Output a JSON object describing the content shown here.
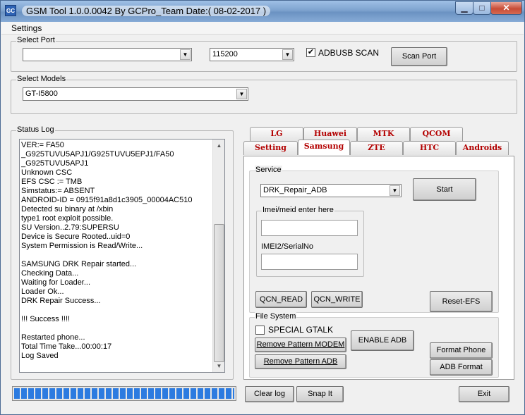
{
  "title": "GSM Tool 1.0.0.0042 By GCPro_Team  Date:( 08-02-2017 )",
  "app_icon": "GC",
  "window_controls": {
    "minimize": "▁",
    "maximize": "□",
    "close": "✕"
  },
  "menu": {
    "settings": "Settings"
  },
  "select_port": {
    "legend": "Select Port",
    "port_value": "",
    "baud_value": "115200",
    "adbusb_label": "ADBUSB SCAN",
    "adbusb_checked": "✔",
    "scan_button": "Scan Port"
  },
  "select_models": {
    "legend": "Select Models",
    "model_value": "GT-I5800"
  },
  "status_log": {
    "legend": "Status Log",
    "text": "VER:= FA50\n_G925TUVU5APJ1/G925TUVU5EPJ1/FA50\n_G925TUVU5APJ1\nUnknown CSC\nEFS CSC := TMB\nSimstatus:= ABSENT\nANDROID-ID = 0915f91a8d1c3905_00004AC510\nDetected su binary at /xbin\ntype1 root exploit possible.\nSU Version..2.79:SUPERSU\nDevice is Secure Rooted..uid=0\nSystem Permission is Read/Write...\n\nSAMSUNG DRK Repair started...\nChecking Data...\nWaiting for Loader...\nLoader Ok...\nDRK Repair Success...\n\n!!! Success !!!!\n\nRestarted phone...\nTotal Time Take...00:00:17\nLog Saved"
  },
  "progress": {
    "fraction": 1.0
  },
  "tabs_row1": [
    "LG",
    "Huawei",
    "MTK",
    "QCOM"
  ],
  "tabs_row2": [
    "Setting",
    "Samsung",
    "ZTE",
    "HTC",
    "Androids"
  ],
  "active_tab": "Samsung",
  "service": {
    "legend": "Service",
    "selected": "DRK_Repair_ADB",
    "start_button": "Start",
    "imei_legend": "Imei/meid enter here",
    "imei_value": "",
    "imei2_label": "IMEI2/SerialNo",
    "imei2_value": "",
    "qcn_read": "QCN_READ",
    "qcn_write": "QCN_WRITE",
    "reset_efs": "Reset-EFS"
  },
  "file_system": {
    "legend": "File System",
    "special_gtalk": "SPECIAL GTALK",
    "remove_pattern_modem": "Remove Pattern MODEM",
    "remove_pattern_adb": "Remove Pattern ADB",
    "enable_adb": "ENABLE ADB",
    "format_phone": "Format Phone",
    "adb_format": "ADB Format"
  },
  "bottom": {
    "clear_log": "Clear log",
    "snap_it": "Snap It",
    "exit": "Exit"
  }
}
